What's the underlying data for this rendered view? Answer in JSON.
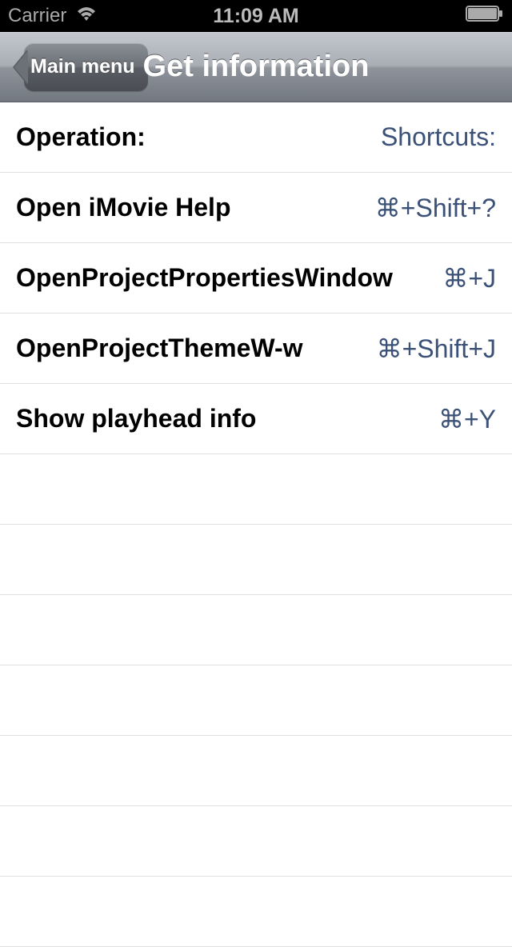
{
  "statusBar": {
    "carrier": "Carrier",
    "time": "11:09 AM"
  },
  "navBar": {
    "backLabel": "Main menu",
    "title": "Get information"
  },
  "table": {
    "header": {
      "operation": "Operation:",
      "shortcut": "Shortcuts:"
    },
    "rows": [
      {
        "operation": "Open iMovie Help",
        "shortcut": "⌘+Shift+?"
      },
      {
        "operation": "OpenProjectPropertiesWindow",
        "shortcut": "⌘+J"
      },
      {
        "operation": "OpenProjectThemeW-w",
        "shortcut": "⌘+Shift+J"
      },
      {
        "operation": "Show playhead info",
        "shortcut": "⌘+Y"
      },
      {
        "operation": "",
        "shortcut": ""
      },
      {
        "operation": "",
        "shortcut": ""
      },
      {
        "operation": "",
        "shortcut": ""
      },
      {
        "operation": "",
        "shortcut": ""
      },
      {
        "operation": "",
        "shortcut": ""
      },
      {
        "operation": "",
        "shortcut": ""
      },
      {
        "operation": "",
        "shortcut": ""
      }
    ]
  }
}
